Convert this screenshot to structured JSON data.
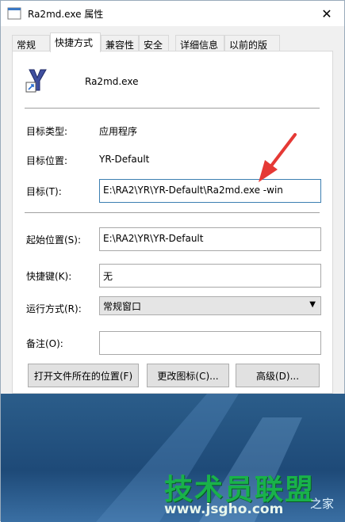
{
  "window": {
    "title": "Ra2md.exe 属性",
    "close_glyph": "✕"
  },
  "tabs": [
    {
      "label": "常规"
    },
    {
      "label": "快捷方式"
    },
    {
      "label": "兼容性"
    },
    {
      "label": "安全"
    },
    {
      "label": "详细信息"
    },
    {
      "label": "以前的版本"
    }
  ],
  "app": {
    "name": "Ra2md.exe"
  },
  "fields": {
    "target_type_label": "目标类型:",
    "target_type_value": "应用程序",
    "target_location_label": "目标位置:",
    "target_location_value": "YR-Default",
    "target_label": "目标(T):",
    "target_value": "E:\\RA2\\YR\\YR-Default\\Ra2md.exe -win",
    "start_in_label": "起始位置(S):",
    "start_in_value": "E:\\RA2\\YR\\YR-Default",
    "shortcut_key_label": "快捷键(K):",
    "shortcut_key_value": "无",
    "run_label": "运行方式(R):",
    "run_value": "常规窗口",
    "comment_label": "备注(O):",
    "comment_value": ""
  },
  "buttons": {
    "open_location": "打开文件所在的位置(F)",
    "change_icon": "更改图标(C)...",
    "advanced": "高级(D)..."
  },
  "watermark": {
    "main": "技术员联盟",
    "url": "www.jsgho.com",
    "side": "之家"
  },
  "colors": {
    "arrow": "#e53935",
    "accent": "#3c7fb1",
    "watermark_green": "#19b24a"
  }
}
